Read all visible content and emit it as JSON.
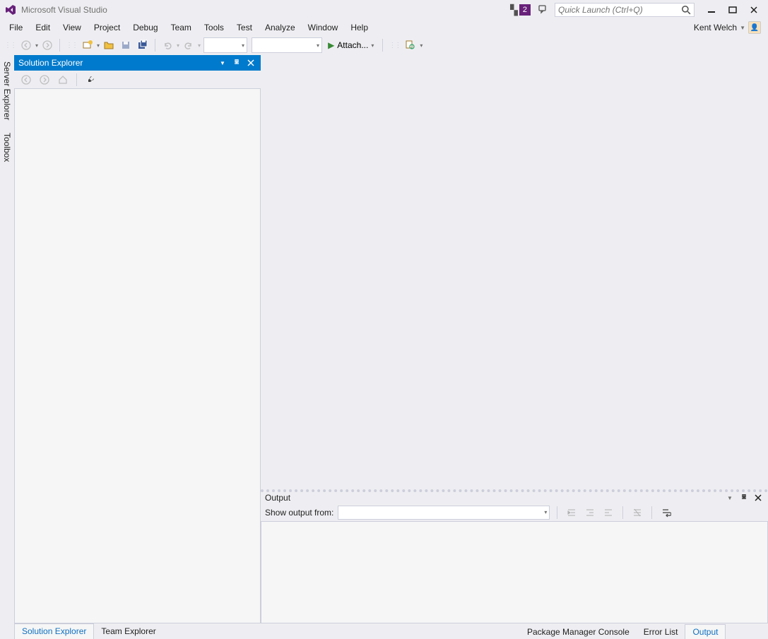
{
  "titlebar": {
    "app_name": "Microsoft Visual Studio",
    "notification_count": "2",
    "search_placeholder": "Quick Launch (Ctrl+Q)"
  },
  "menubar": {
    "items": [
      "File",
      "Edit",
      "View",
      "Project",
      "Debug",
      "Team",
      "Tools",
      "Test",
      "Analyze",
      "Window",
      "Help"
    ],
    "user_name": "Kent Welch"
  },
  "toolbar": {
    "attach_label": "Attach..."
  },
  "left_vertical_tabs": [
    "Server Explorer",
    "Toolbox"
  ],
  "solution_explorer": {
    "title": "Solution Explorer"
  },
  "output_panel": {
    "title": "Output",
    "show_from_label": "Show output from:"
  },
  "bottom_tabs_left": [
    {
      "label": "Solution Explorer",
      "active": true
    },
    {
      "label": "Team Explorer",
      "active": false
    }
  ],
  "bottom_tabs_right": [
    {
      "label": "Package Manager Console",
      "active": false
    },
    {
      "label": "Error List",
      "active": false
    },
    {
      "label": "Output",
      "active": true
    }
  ]
}
